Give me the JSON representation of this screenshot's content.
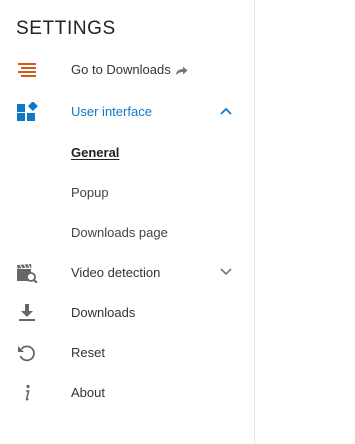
{
  "settings": {
    "title": "SETTINGS",
    "accent_color": "#0f79c8",
    "orange_color": "#d15a1c",
    "icon_gray": "#666666"
  },
  "menu": {
    "go_to_downloads": {
      "label": "Go to Downloads",
      "icon": "list-lines-icon",
      "trailing_icon": "external-arrow-icon"
    },
    "user_interface": {
      "label": "User interface",
      "icon": "dashboard-icon",
      "expanded": true,
      "children": [
        {
          "label": "General",
          "selected": true
        },
        {
          "label": "Popup"
        },
        {
          "label": "Downloads page"
        }
      ]
    },
    "video_detection": {
      "label": "Video detection",
      "icon": "video-search-icon",
      "expanded": false
    },
    "downloads": {
      "label": "Downloads",
      "icon": "download-icon"
    },
    "reset": {
      "label": "Reset",
      "icon": "reset-icon"
    },
    "about": {
      "label": "About",
      "icon": "info-icon"
    }
  }
}
